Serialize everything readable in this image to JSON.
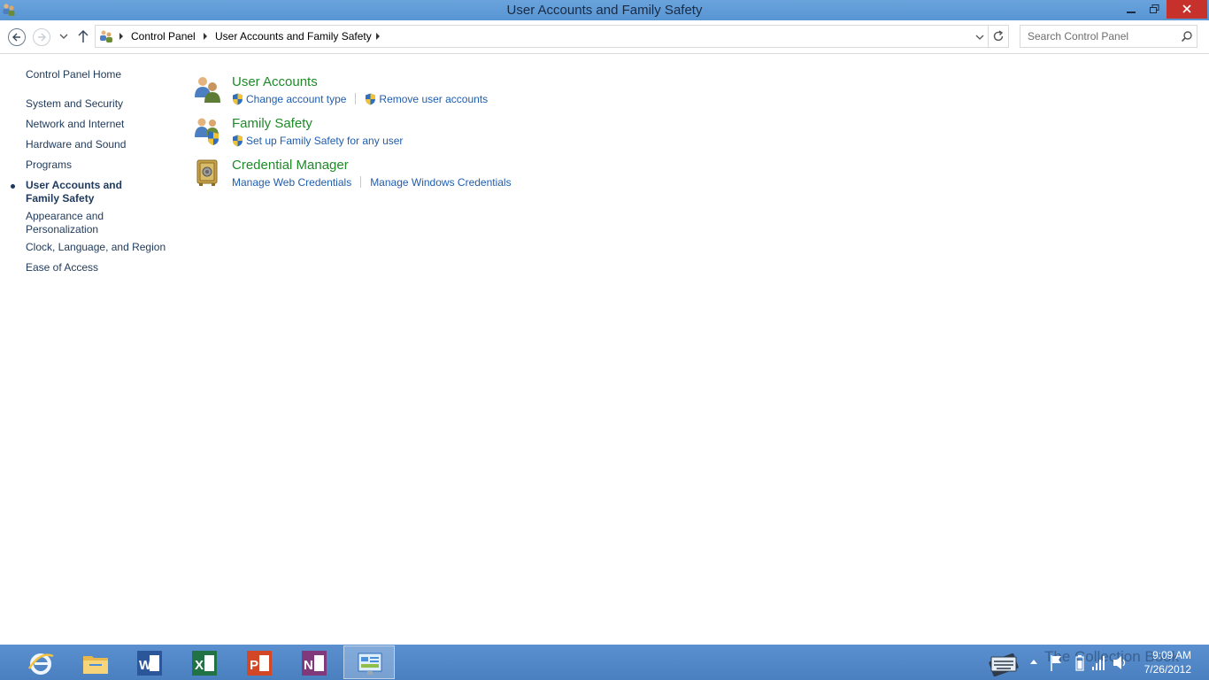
{
  "window": {
    "title": "User Accounts and Family Safety",
    "minimize_glyph": "🗕",
    "maximize_glyph": "🗗",
    "close_glyph": "✕"
  },
  "address_bar": {
    "breadcrumbs": [
      "Control Panel",
      "User Accounts and Family Safety"
    ],
    "search_placeholder": "Search Control Panel"
  },
  "left_nav": {
    "home": "Control Panel Home",
    "items": [
      "System and Security",
      "Network and Internet",
      "Hardware and Sound",
      "Programs",
      "User Accounts and Family Safety",
      "Appearance and Personalization",
      "Clock, Language, and Region",
      "Ease of Access"
    ],
    "active_item": "User Accounts and Family Safety"
  },
  "categories": [
    {
      "title": "User Accounts",
      "icon": "users-icon",
      "links": [
        {
          "label": "Change account type",
          "shield": true
        },
        {
          "label": "Remove user accounts",
          "shield": true
        }
      ]
    },
    {
      "title": "Family Safety",
      "icon": "family-safety-icon",
      "links": [
        {
          "label": "Set up Family Safety for any user",
          "shield": true
        }
      ]
    },
    {
      "title": "Credential Manager",
      "icon": "vault-icon",
      "links": [
        {
          "label": "Manage Web Credentials",
          "shield": false
        },
        {
          "label": "Manage Windows Credentials",
          "shield": false
        }
      ]
    }
  ],
  "taskbar": {
    "apps": [
      "internet-explorer-icon",
      "file-explorer-icon",
      "word-icon",
      "excel-icon",
      "powerpoint-icon",
      "onenote-icon",
      "control-panel-icon"
    ],
    "active_app": "control-panel-icon",
    "clock_time": "9:09 AM",
    "clock_date": "7/26/2012",
    "watermark": "The Collection Book"
  },
  "colors": {
    "titlebar": "#5b9bd5",
    "category_title": "#1f8a28",
    "link": "#1f5dae",
    "nav_text": "#1e395b",
    "close_button": "#c7312b",
    "taskbar": "#4f86c6"
  }
}
